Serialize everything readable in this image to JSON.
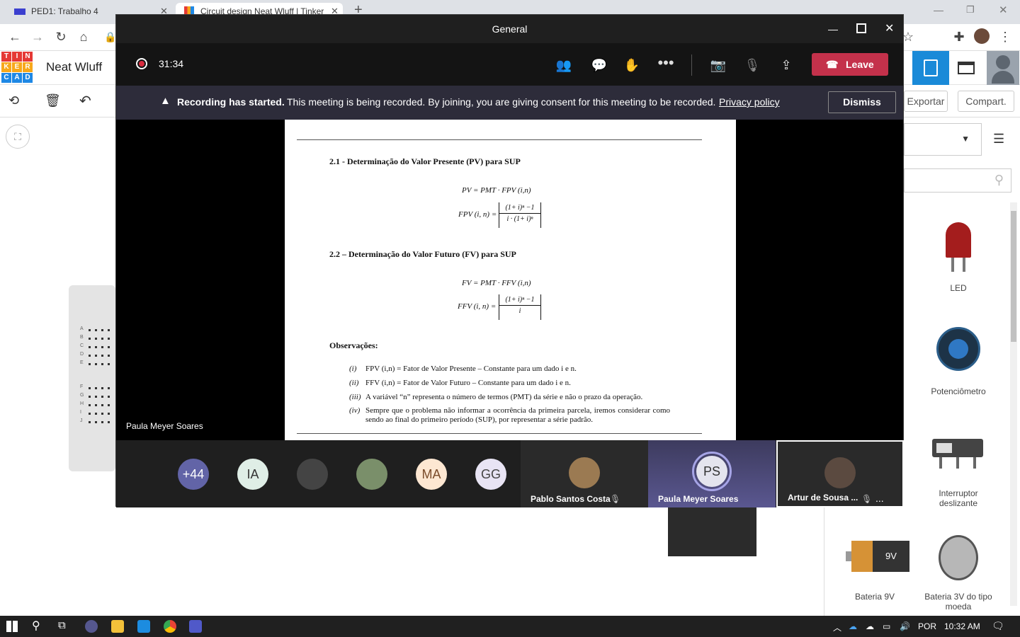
{
  "browser": {
    "tabs": [
      {
        "title": "PED1: Trabalho 4"
      },
      {
        "title": "Circuit design Neat Wluff | Tinker"
      }
    ],
    "new_tab": "+"
  },
  "tinkercad": {
    "logo_letters": [
      "T",
      "I",
      "N",
      "K",
      "E",
      "R",
      "C",
      "A",
      "D"
    ],
    "logo_colors": [
      "#e53935",
      "#e53935",
      "#e53935",
      "#f7a81b",
      "#f7a81b",
      "#f7a81b",
      "#1e88e5",
      "#1e88e5",
      "#1e88e5"
    ],
    "design_name": "Neat Wluff",
    "export_label": "Exportar",
    "share_label": "Compart.",
    "components": [
      {
        "label": "LED"
      },
      {
        "label": "Potenciômetro"
      },
      {
        "label": "Interruptor deslizante"
      },
      {
        "label": "Bateria 9V"
      },
      {
        "label": "Bateria 3V do tipo moeda"
      }
    ],
    "battery_text": "9V",
    "breadboard_rows": [
      "A",
      "B",
      "C",
      "D",
      "E",
      "F",
      "G",
      "H",
      "I",
      "J"
    ]
  },
  "teams": {
    "window_title": "General",
    "timer": "31:34",
    "leave_label": "Leave",
    "banner": {
      "title": "Recording has started.",
      "message": "This meeting is being recorded. By joining, you are giving consent for this meeting to be recorded.",
      "link": "Privacy policy",
      "dismiss": "Dismiss"
    },
    "presenter_name": "Paula Meyer Soares",
    "document": {
      "section1": "2.1 - Determinação do Valor Presente (PV) para SUP",
      "formula1a": "PV = PMT · FPV (i,n)",
      "formula1b_lhs": "FPV (i, n) =",
      "formula1b_num": "(1+ i)ⁿ −1",
      "formula1b_den": "i · (1+ i)ⁿ",
      "section2": "2.2 – Determinação do Valor Futuro (FV) para SUP",
      "formula2a": "FV = PMT · FFV (i,n)",
      "formula2b_lhs": "FFV (i, n) =",
      "formula2b_num": "(1+ i)ⁿ −1",
      "formula2b_den": "i",
      "obs_title": "Observações:",
      "obs": [
        {
          "num": "(i)",
          "text": "FPV (i,n) = Fator de Valor Presente – Constante para um dado i e n."
        },
        {
          "num": "(ii)",
          "text": "FFV (i,n) = Fator de Valor Futuro  – Constante para um dado i e n."
        },
        {
          "num": "(iii)",
          "text": "A variável “n” representa o número de termos (PMT) da série e não o prazo da operação."
        },
        {
          "num": "(iv)",
          "text": "Sempre que o problema não informar a ocorrência da primeira parcela, iremos considerar como sendo ao final do primeiro período (SUP), por representar a série padrão."
        }
      ]
    },
    "gallery_avatars": [
      {
        "initials": "+44",
        "bg": "#6264a7",
        "fg": "#ffffff"
      },
      {
        "initials": "IA",
        "bg": "#dfeee6",
        "fg": "#333333"
      },
      {
        "initials": "",
        "bg": "#444444",
        "fg": "#ffffff"
      },
      {
        "initials": "",
        "bg": "#7a8f6a",
        "fg": "#ffffff"
      },
      {
        "initials": "MA",
        "bg": "#fde7d2",
        "fg": "#7a4b2a"
      },
      {
        "initials": "GG",
        "bg": "#e8e4f4",
        "fg": "#444444"
      }
    ],
    "video_tiles": [
      {
        "name": "Pablo Santos Costa"
      },
      {
        "name": "Paula Meyer Soares",
        "initials": "PS"
      },
      {
        "name": "Artur de Sousa ..."
      }
    ],
    "more": "..."
  },
  "taskbar": {
    "language": "POR",
    "time": "10:32 AM"
  }
}
